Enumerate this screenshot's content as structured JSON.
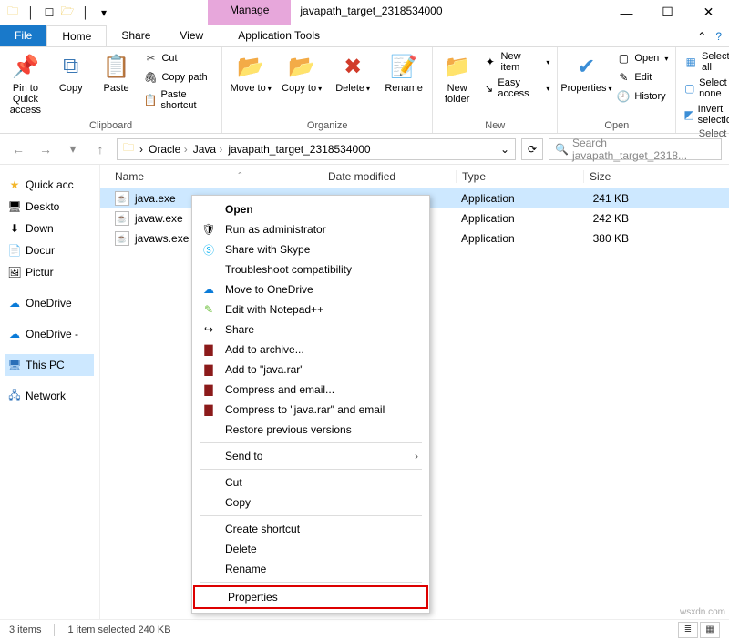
{
  "title": {
    "manage": "Manage",
    "folder": "javapath_target_2318534000"
  },
  "tabs": {
    "file": "File",
    "home": "Home",
    "share": "Share",
    "view": "View",
    "apptools": "Application Tools"
  },
  "ribbon": {
    "pin": "Pin to Quick access",
    "copy": "Copy",
    "paste": "Paste",
    "cut": "Cut",
    "copypath": "Copy path",
    "pasteshort": "Paste shortcut",
    "clipboard": "Clipboard",
    "moveto": "Move to",
    "copyto": "Copy to",
    "delete": "Delete",
    "rename": "Rename",
    "organize": "Organize",
    "newfolder": "New folder",
    "newitem": "New item",
    "easyaccess": "Easy access",
    "new": "New",
    "properties": "Properties",
    "open": "Open",
    "edit": "Edit",
    "history": "History",
    "open_group": "Open",
    "selectall": "Select all",
    "selectnone": "Select none",
    "invertsel": "Invert selection",
    "select": "Select"
  },
  "breadcrumb": [
    "Oracle",
    "Java",
    "javapath_target_2318534000"
  ],
  "search_placeholder": "Search javapath_target_2318...",
  "sidebar": {
    "quick": "Quick acc",
    "desktop": "Deskto",
    "down": "Down",
    "docs": "Docur",
    "pics": "Pictur",
    "onedrive": "OneDrive",
    "onedrive2": "OneDrive -",
    "thispc": "This PC",
    "network": "Network"
  },
  "columns": {
    "name": "Name",
    "date": "Date modified",
    "type": "Type",
    "size": "Size"
  },
  "files": [
    {
      "name": "java.exe",
      "date": "",
      "type": "Application",
      "size": "241 KB"
    },
    {
      "name": "javaw.exe",
      "date": "",
      "type": "Application",
      "size": "242 KB"
    },
    {
      "name": "javaws.exe",
      "date": "",
      "type": "Application",
      "size": "380 KB"
    }
  ],
  "context": {
    "open": "Open",
    "runadmin": "Run as administrator",
    "skype": "Share with Skype",
    "troubleshoot": "Troubleshoot compatibility",
    "onedrive": "Move to OneDrive",
    "notepad": "Edit with Notepad++",
    "share": "Share",
    "archive": "Add to archive...",
    "javarar": "Add to \"java.rar\"",
    "compressemail": "Compress and email...",
    "compressjavarar": "Compress to \"java.rar\" and email",
    "restore": "Restore previous versions",
    "sendto": "Send to",
    "cut": "Cut",
    "copy": "Copy",
    "shortcut": "Create shortcut",
    "delete": "Delete",
    "rename": "Rename",
    "properties": "Properties"
  },
  "status": {
    "items": "3 items",
    "selected": "1 item selected  240 KB"
  },
  "watermark": "wsxdn.com"
}
